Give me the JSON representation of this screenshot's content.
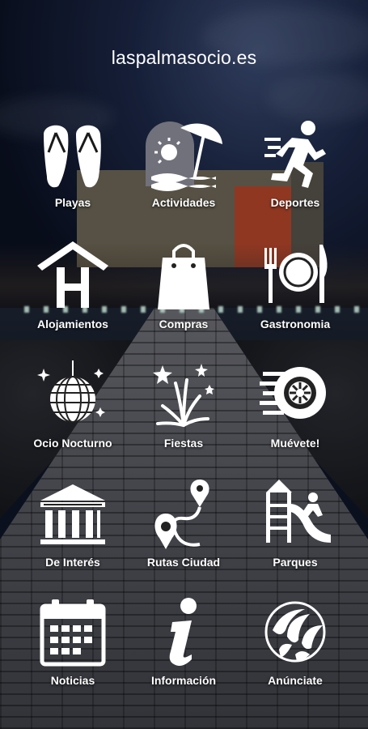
{
  "header": {
    "title": "laspalmasocio.es"
  },
  "menu": [
    {
      "label": "Playas",
      "icon": "flip-flops-icon"
    },
    {
      "label": "Actividades",
      "icon": "beach-sun-umbrella-icon"
    },
    {
      "label": "Deportes",
      "icon": "running-man-icon"
    },
    {
      "label": "Alojamientos",
      "icon": "hotel-icon"
    },
    {
      "label": "Compras",
      "icon": "shopping-bag-icon"
    },
    {
      "label": "Gastronomia",
      "icon": "fork-plate-knife-icon"
    },
    {
      "label": "Ocio Nocturno",
      "icon": "disco-ball-icon"
    },
    {
      "label": "Fiestas",
      "icon": "fireworks-icon"
    },
    {
      "label": "Muévete!",
      "icon": "wheel-icon"
    },
    {
      "label": "De Interés",
      "icon": "museum-icon"
    },
    {
      "label": "Rutas Ciudad",
      "icon": "route-icon"
    },
    {
      "label": "Parques",
      "icon": "playground-slide-icon"
    },
    {
      "label": "Noticias",
      "icon": "calendar-icon"
    },
    {
      "label": "Información",
      "icon": "info-icon"
    },
    {
      "label": "Anúnciate",
      "icon": "palm-leaf-icon"
    }
  ]
}
